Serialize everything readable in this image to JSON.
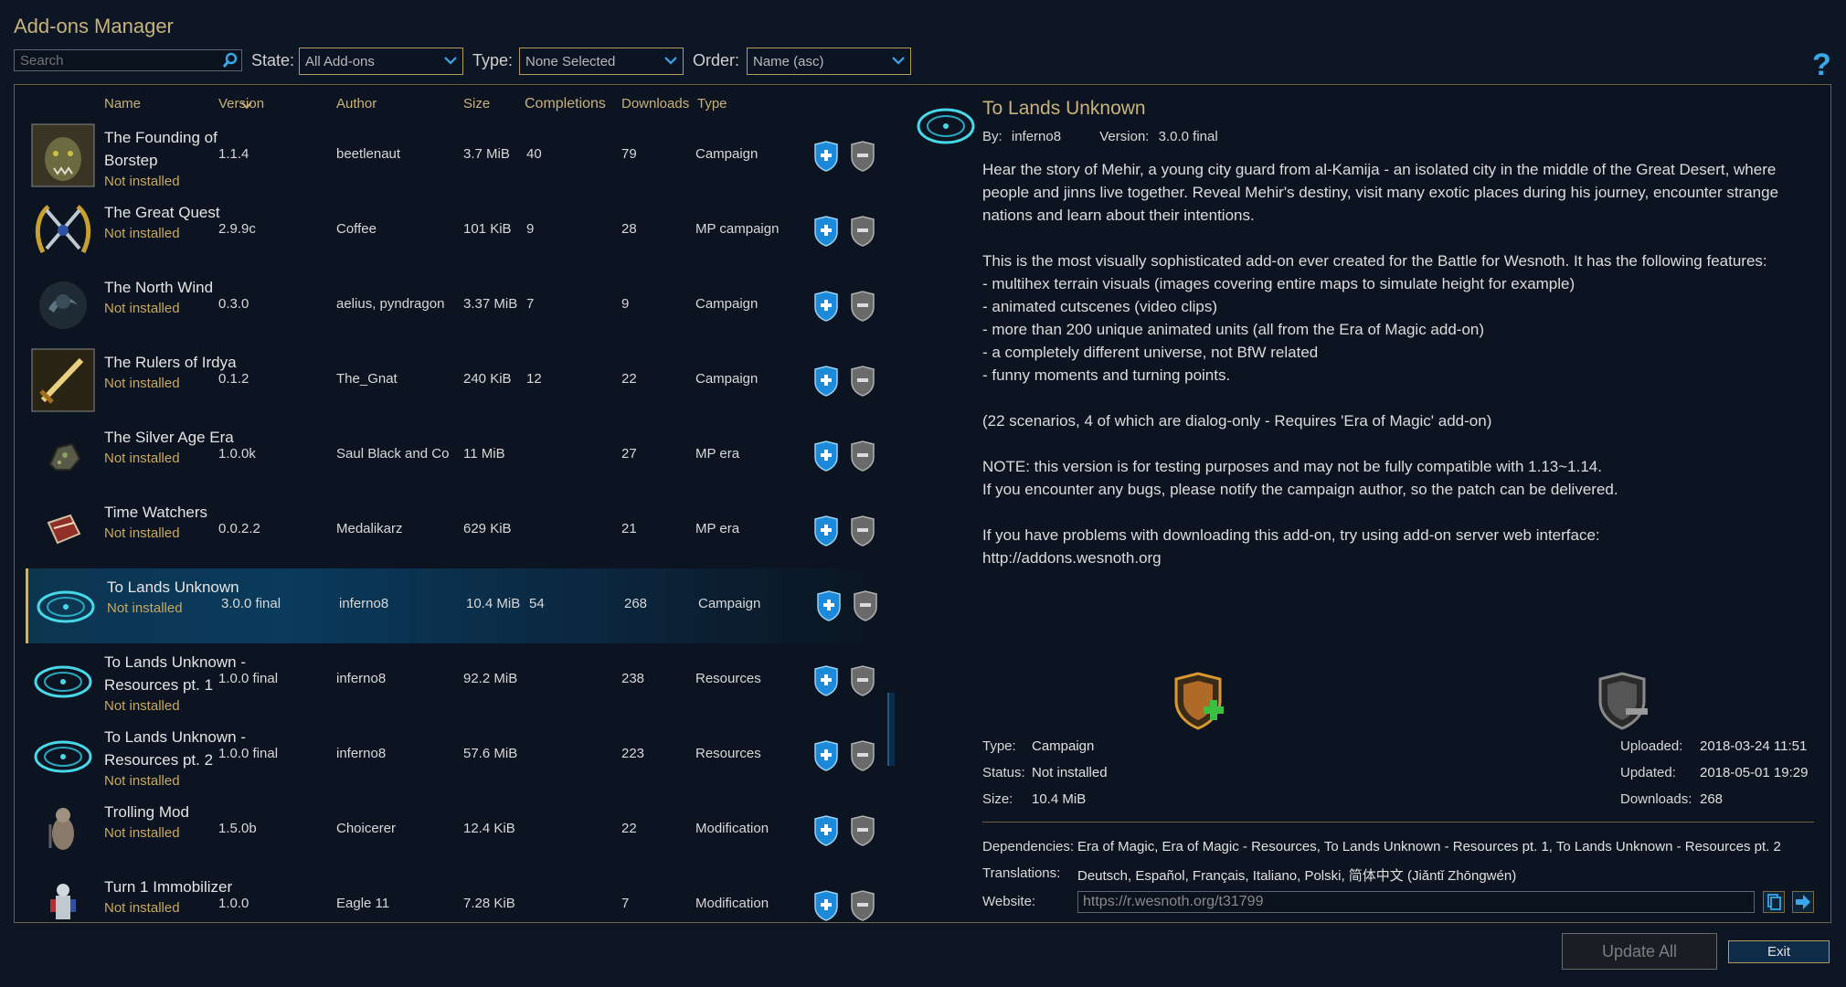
{
  "dialog": {
    "title": "Add-ons Manager"
  },
  "filters": {
    "search_placeholder": "Search",
    "state_label": "State:",
    "state_value": "All Add-ons",
    "type_label": "Type:",
    "type_value": "None Selected",
    "order_label": "Order:",
    "order_value": "Name (asc)",
    "help": "?"
  },
  "columns": {
    "name": "Name",
    "version": "Version",
    "author": "Author",
    "size": "Size",
    "completions": "Completions",
    "downloads": "Downloads",
    "type": "Type"
  },
  "addons": [
    {
      "name": "The Founding of Borstep",
      "state": "Not installed",
      "version": "1.1.4",
      "author": "beetlenaut",
      "size": "3.7 MiB",
      "completions": "40",
      "downloads": "79",
      "type": "Campaign",
      "icon": "orc-portrait-icon"
    },
    {
      "name": "The Great Quest",
      "state": "Not installed",
      "version": "2.9.9c",
      "author": "Coffee",
      "size": "101 KiB",
      "completions": "9",
      "downloads": "28",
      "type": "MP campaign",
      "icon": "crossed-swords-laurel-icon"
    },
    {
      "name": "The North Wind",
      "state": "Not installed",
      "version": "0.3.0",
      "author": "aelius, pyndragon",
      "size": "3.37 MiB",
      "completions": "7",
      "downloads": "9",
      "type": "Campaign",
      "icon": "ghost-wind-icon"
    },
    {
      "name": "The Rulers of Irdya",
      "state": "Not installed",
      "version": "0.1.2",
      "author": "The_Gnat",
      "size": "240 KiB",
      "completions": "12",
      "downloads": "22",
      "type": "Campaign",
      "icon": "golden-sword-icon"
    },
    {
      "name": "The Silver Age Era",
      "state": "Not installed",
      "version": "1.0.0k",
      "author": "Saul Black and Co",
      "size": "11 MiB",
      "completions": "",
      "downloads": "27",
      "type": "MP era",
      "icon": "ore-rock-icon"
    },
    {
      "name": "Time Watchers",
      "state": "Not installed",
      "version": "0.0.2.2",
      "author": "Medalikarz",
      "size": "629 KiB",
      "completions": "",
      "downloads": "21",
      "type": "MP era",
      "icon": "book-icon"
    },
    {
      "name": "To Lands Unknown",
      "state": "Not installed",
      "version": "3.0.0 final",
      "author": "inferno8",
      "size": "10.4 MiB",
      "completions": "54",
      "downloads": "268",
      "type": "Campaign",
      "icon": "magic-circle-icon"
    },
    {
      "name": "To Lands Unknown - Resources pt. 1",
      "state": "Not installed",
      "version": "1.0.0 final",
      "author": "inferno8",
      "size": "92.2 MiB",
      "completions": "",
      "downloads": "238",
      "type": "Resources",
      "icon": "magic-circle-icon"
    },
    {
      "name": "To Lands Unknown - Resources pt. 2",
      "state": "Not installed",
      "version": "1.0.0 final",
      "author": "inferno8",
      "size": "57.6 MiB",
      "completions": "",
      "downloads": "223",
      "type": "Resources",
      "icon": "magic-circle-icon"
    },
    {
      "name": "Trolling Mod",
      "state": "Not installed",
      "version": "1.5.0b",
      "author": "Choicerer",
      "size": "12.4 KiB",
      "completions": "",
      "downloads": "22",
      "type": "Modification",
      "icon": "troll-unit-icon"
    },
    {
      "name": "Turn 1 Immobilizer",
      "state": "Not installed",
      "version": "1.0.0",
      "author": "Eagle 11",
      "size": "7.28 KiB",
      "completions": "",
      "downloads": "7",
      "type": "Modification",
      "icon": "knight-unit-icon"
    }
  ],
  "selected_index": 6,
  "detail": {
    "title": "To Lands Unknown",
    "by_label": "By:",
    "author": "inferno8",
    "version_label": "Version:",
    "version": "3.0.0 final",
    "description": "Hear the story of Mehir, a young city guard from al-Kamija - an isolated city in the middle of the Great Desert, where people and jinns live together. Reveal Mehir's destiny, visit many exotic places during his journey, encounter strange nations and learn about their intentions.\n\nThis is the most visually sophisticated add-on ever created for the Battle for Wesnoth. It has the following features:\n- multihex terrain visuals (images covering entire maps to simulate height for example)\n- animated cutscenes (video clips)\n- more than 200 unique animated units (all from the Era of Magic add-on)\n- a completely different universe, not BfW related\n- funny moments and turning points.\n\n(22 scenarios, 4 of which are dialog-only - Requires 'Era of Magic' add-on)\n\nNOTE: this version is for testing purposes and may not be fully compatible with 1.13~1.14.\nIf you encounter any bugs, please notify the campaign author, so the patch can be delivered.\n\nIf you have problems with downloading this add-on, try using add-on server web interface:\nhttp://addons.wesnoth.org",
    "type_label": "Type:",
    "type": "Campaign",
    "status_label": "Status:",
    "status": "Not installed",
    "size_label": "Size:",
    "size": "10.4 MiB",
    "uploaded_label": "Uploaded:",
    "uploaded": "2018-03-24 11:51",
    "updated_label": "Updated:",
    "updated": "2018-05-01 19:29",
    "downloads_label": "Downloads:",
    "downloads": "268",
    "dependencies_label": "Dependencies:",
    "dependencies": "Era of Magic, Era of Magic - Resources, To Lands Unknown - Resources pt. 1, To Lands Unknown - Resources pt. 2",
    "translations_label": "Translations:",
    "translations": "Deutsch, Español, Français, Italiano, Polski, 简体中文 (Jiǎntǐ Zhōngwén)",
    "website_label": "Website:",
    "website": "https://r.wesnoth.org/t31799"
  },
  "footer": {
    "update_all": "Update All",
    "exit": "Exit"
  },
  "colors": {
    "accent_gold": "#c9b27a",
    "accent_blue": "#38a8e8",
    "state_text": "#c9a860",
    "frame": "#6d6040"
  }
}
